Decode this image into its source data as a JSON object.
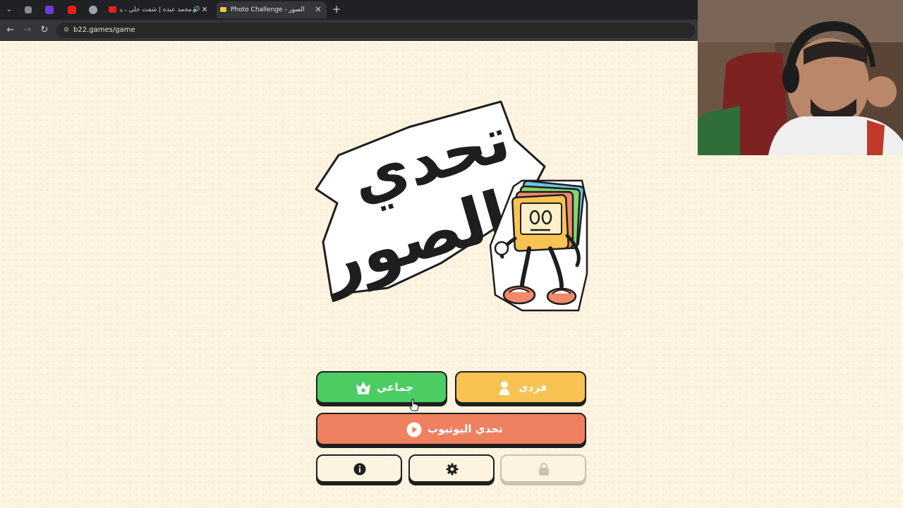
{
  "browser": {
    "tabs": [
      {
        "title": "محمد عبده | شفت خلي ، يعـ",
        "audio": true,
        "active": false
      },
      {
        "title": "Photo Challenge - تحدي الصور",
        "audio": false,
        "active": true
      }
    ],
    "url": "b22.games/game"
  },
  "game": {
    "logo_text_line1": "تحدي",
    "logo_text_line2": "الصور",
    "buttons": {
      "group": "جماعي",
      "solo": "فردي",
      "youtube": "تحدي اليوتيوب"
    },
    "colors": {
      "background": "#fcf4e0",
      "group": "#4ccd64",
      "solo": "#f8c352",
      "youtube": "#ef8060",
      "outline": "#1f1f1f"
    },
    "icons": [
      "crown-icon",
      "person-icon",
      "play-icon",
      "info-icon",
      "gear-icon",
      "lock-icon"
    ]
  }
}
